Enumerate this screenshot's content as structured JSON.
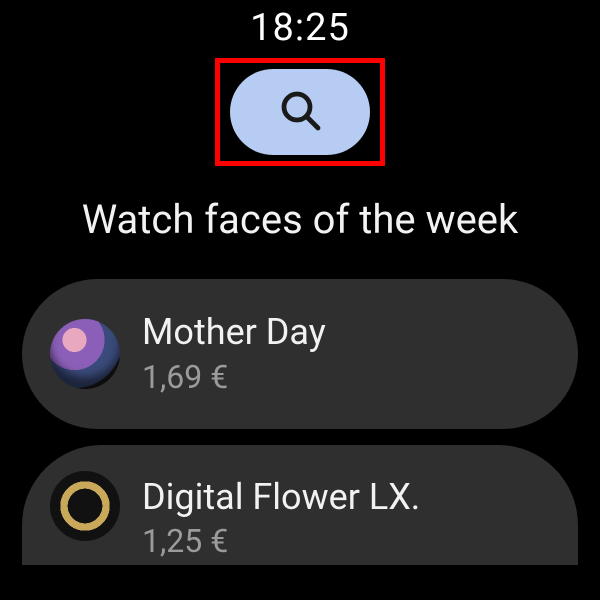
{
  "status": {
    "time": "18:25"
  },
  "annotation": {
    "highlight_color": "#ff0000"
  },
  "search": {
    "accent": "#b6ccf2"
  },
  "heading": "Watch faces of the week",
  "items": [
    {
      "title": "Mother Day",
      "price": "1,69 €"
    },
    {
      "title": "Digital Flower LX.",
      "price": "1,25 €"
    }
  ]
}
